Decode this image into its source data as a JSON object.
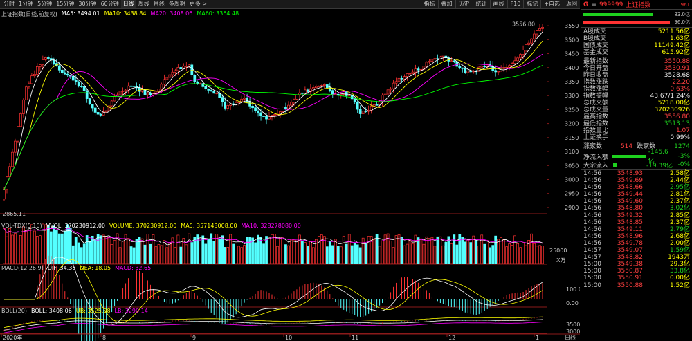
{
  "toolbar": {
    "periods": [
      "分时",
      "1分钟",
      "5分钟",
      "15分钟",
      "30分钟",
      "60分钟",
      "日线",
      "周线",
      "月线",
      "多周期",
      "更多 >"
    ],
    "active_period": "日线",
    "right_tools": [
      "指标",
      "叠加",
      "历史",
      "统计",
      "画线",
      "F10",
      "标记",
      "+自选",
      "返回"
    ],
    "left_icon": "口"
  },
  "main_title": {
    "name": "上证指数(日线,前复权)",
    "ma5": "MA5: 3494.01",
    "ma10": "MA10: 3438.84",
    "ma20": "MA20: 3408.06",
    "ma60": "MA60: 3364.48"
  },
  "price_axis": [
    "3550",
    "3500",
    "3450",
    "3400",
    "3350",
    "3300",
    "3250",
    "3200",
    "3150",
    "3100",
    "3050",
    "3000",
    "2950",
    "2900"
  ],
  "price_labels": {
    "high": "3556.80",
    "low": "2865.11"
  },
  "vol_title": {
    "name": "VOL-TDX(5,10)",
    "vvol": "VVOL: 370230912.00",
    "volume": "VOLUME: 370230912.00",
    "ma5": "MA5: 357143008.00",
    "ma10": "MA10: 328278080.00"
  },
  "vol_axis": [
    "25000",
    "X万"
  ],
  "macd_title": {
    "name": "MACD(12,26,9)",
    "dif": "DIF: 34.38",
    "dea": "DEA: 18.05",
    "macd": "MACD: 32.65"
  },
  "macd_axis": [
    "100.0",
    "0.00"
  ],
  "boll_title": {
    "name": "BOLL(20)",
    "boll": "BOLL: 3408.06",
    "ub": "UB: 3525.98",
    "lb": "LB: 3290.14"
  },
  "boll_axis": [
    "3500",
    "3000"
  ],
  "date_axis": [
    "2020年",
    "8",
    "9",
    "10",
    "11",
    "12",
    "1"
  ],
  "date_axis_right": "日线",
  "colors": {
    "up": "#ff3232",
    "down": "#54ffff",
    "ma5": "#ffffff",
    "ma10": "#ffff00",
    "ma20": "#ff00ff",
    "ma60": "#00ff00"
  },
  "panel": {
    "header": {
      "badge": "G",
      "icon": "≡",
      "code": "999999",
      "name": "上证指数",
      "count": "961"
    },
    "top_bars": [
      "83.0亿",
      "96.0亿"
    ],
    "turnover": [
      {
        "label": "A股成交",
        "value": "5211.56亿"
      },
      {
        "label": "B股成交",
        "value": "1.63亿"
      },
      {
        "label": "国债成交",
        "value": "11149.42亿"
      },
      {
        "label": "基金成交",
        "value": "615.92亿"
      }
    ],
    "stats": [
      {
        "label": "最新指数",
        "value": "3550.88",
        "color": "red"
      },
      {
        "label": "今日开盘",
        "value": "3530.91",
        "color": "red"
      },
      {
        "label": "昨日收盘",
        "value": "3528.68",
        "color": "wht"
      },
      {
        "label": "指数涨跌",
        "value": "22.20",
        "color": "red"
      },
      {
        "label": "指数涨幅",
        "value": "0.63%",
        "color": "red"
      },
      {
        "label": "指数振幅",
        "value": "43.67/1.24%",
        "color": "wht"
      },
      {
        "label": "总成交额",
        "value": "5218.00亿",
        "color": "yellow"
      },
      {
        "label": "总成交量",
        "value": "370230926",
        "color": "yellow"
      },
      {
        "label": "最高指数",
        "value": "3556.80",
        "color": "red"
      },
      {
        "label": "最低指数",
        "value": "3513.13",
        "color": "green"
      },
      {
        "label": "指数量比",
        "value": "1.07",
        "color": "red"
      },
      {
        "label": "上证换手",
        "value": "0.99%",
        "color": "wht"
      }
    ],
    "updown": {
      "up_label": "涨家数",
      "up": "514",
      "down_label": "跌家数",
      "down": "1274"
    },
    "flows": [
      {
        "label": "净流入额",
        "value": "-145.6亿",
        "pct": "-3%"
      },
      {
        "label": "大宗流入",
        "value": "-19.39亿",
        "pct": "-0%"
      }
    ],
    "ticks": [
      {
        "time": "14:56",
        "price": "3548.93",
        "vol": "2.58亿"
      },
      {
        "time": "14:56",
        "price": "3549.69",
        "vol": "2.44亿"
      },
      {
        "time": "14:56",
        "price": "3548.66",
        "vol": "2.95亿"
      },
      {
        "time": "14:56",
        "price": "3549.44",
        "vol": "2.81亿"
      },
      {
        "time": "14:56",
        "price": "3549.60",
        "vol": "2.37亿"
      },
      {
        "time": "14:56",
        "price": "3548.80",
        "vol": "3.02亿"
      },
      {
        "time": "14:56",
        "price": "3549.32",
        "vol": "2.85亿"
      },
      {
        "time": "14:56",
        "price": "3548.85",
        "vol": "2.37亿"
      },
      {
        "time": "14:56",
        "price": "3549.11",
        "vol": "2.79亿"
      },
      {
        "time": "14:56",
        "price": "3548.96",
        "vol": "2.68亿"
      },
      {
        "time": "14:56",
        "price": "3549.78",
        "vol": "2.00亿"
      },
      {
        "time": "14:57",
        "price": "3549.07",
        "vol": "1.59亿"
      },
      {
        "time": "14:57",
        "price": "3548.82",
        "vol": "1943万"
      },
      {
        "time": "15:00",
        "price": "3549.38",
        "vol": "29.3亿"
      },
      {
        "time": "15:00",
        "price": "3550.87",
        "vol": "33.8亿"
      },
      {
        "time": "15:00",
        "price": "3550.91",
        "vol": "0.00亿"
      },
      {
        "time": "15:00",
        "price": "3550.88",
        "vol": "1.52亿"
      }
    ]
  }
}
